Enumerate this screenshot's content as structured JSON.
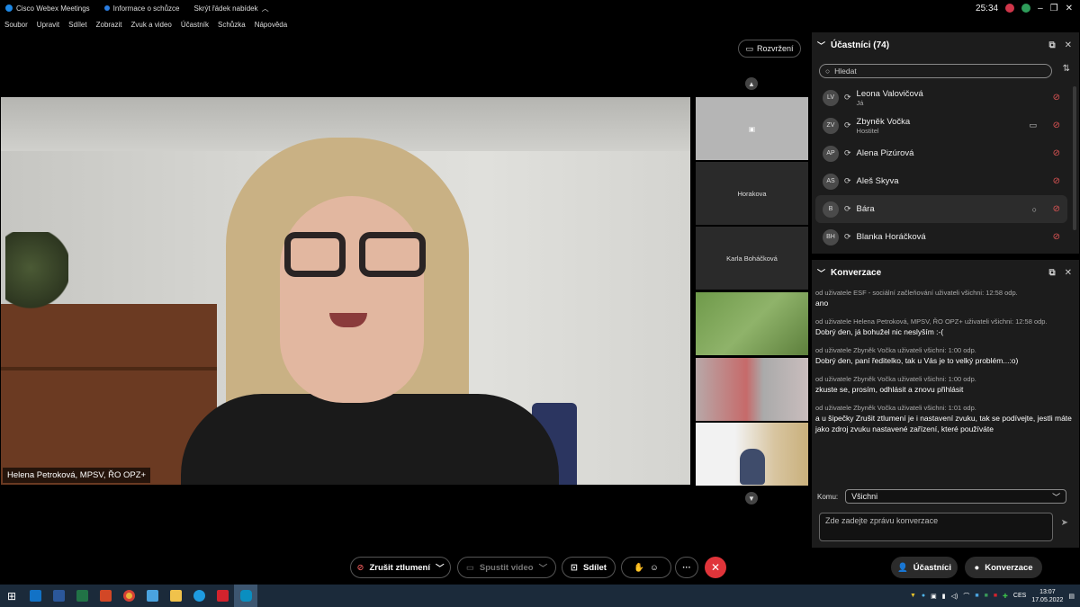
{
  "titlebar": {
    "app_title": "Cisco Webex Meetings",
    "info": "Informace o schůzce",
    "hide_menu": "Skrýt řádek nabídek",
    "time": "25:34"
  },
  "menu": [
    "Soubor",
    "Upravit",
    "Sdílet",
    "Zobrazit",
    "Zvuk a video",
    "Účastník",
    "Schůzka",
    "Nápověda"
  ],
  "layout_button": "Rozvržení",
  "main_video": {
    "name": "Helena Petroková, MPSV, ŘO OPZ+"
  },
  "thumbnails": [
    {
      "label": ""
    },
    {
      "label": "Horakova"
    },
    {
      "label": "Karla Boháčková"
    },
    {
      "label": ""
    },
    {
      "label": ""
    },
    {
      "label": ""
    }
  ],
  "participants": {
    "title": "Účastníci (74)",
    "search_placeholder": "Hledat",
    "list": [
      {
        "initials": "LV",
        "name": "Leona Valovičová",
        "role": "Já"
      },
      {
        "initials": "ZV",
        "name": "Zbyněk Vočka",
        "role": "Hostitel"
      },
      {
        "initials": "AP",
        "name": "Alena Pizúrová",
        "role": ""
      },
      {
        "initials": "AS",
        "name": "Aleš Skyva",
        "role": ""
      },
      {
        "initials": "B",
        "name": "Bára",
        "role": ""
      },
      {
        "initials": "BH",
        "name": "Blanka Horáčková",
        "role": ""
      }
    ]
  },
  "chat": {
    "title": "Konverzace",
    "messages": [
      {
        "meta": "od uživatele ESF - sociální začleňování uživateli všichni:     12:58 odp.",
        "text": "ano"
      },
      {
        "meta": "od uživatele Helena Petroková, MPSV, ŘO OPZ+ uživateli všichni:  12:58 odp.",
        "text": "Dobrý den, já bohužel nic neslyším :-("
      },
      {
        "meta": "od uživatele Zbyněk Vočka uživateli všichni:     1:00 odp.",
        "text": "Dobrý den, paní ředitelko, tak u Vás je to velký problém...:o)"
      },
      {
        "meta": "od uživatele Zbyněk Vočka uživateli všichni:     1:00 odp.",
        "text": "zkuste se, prosím, odhlásit a znovu přihlásit"
      },
      {
        "meta": "od uživatele Zbyněk Vočka uživateli všichni:     1:01 odp.",
        "text": "a u šipečky Zrušit ztlumení je i nastavení zvuku, tak se podívejte, jestli máte jako zdroj zvuku nastavené zařízení, které používáte"
      }
    ],
    "to_label": "Komu:",
    "to_value": "Všichni",
    "input_placeholder": "Zde zadejte zprávu konverzace"
  },
  "controls": {
    "unmute": "Zrušit ztlumení",
    "start_video": "Spustit video",
    "share": "Sdílet",
    "participants": "Účastníci",
    "chat": "Konverzace"
  },
  "taskbar": {
    "lang": "CES",
    "time": "13:07",
    "date": "17.05.2022"
  },
  "colors": {
    "end_call": "#e0343a",
    "muted": "#e05555",
    "panel_bg": "#1c1c1c"
  }
}
